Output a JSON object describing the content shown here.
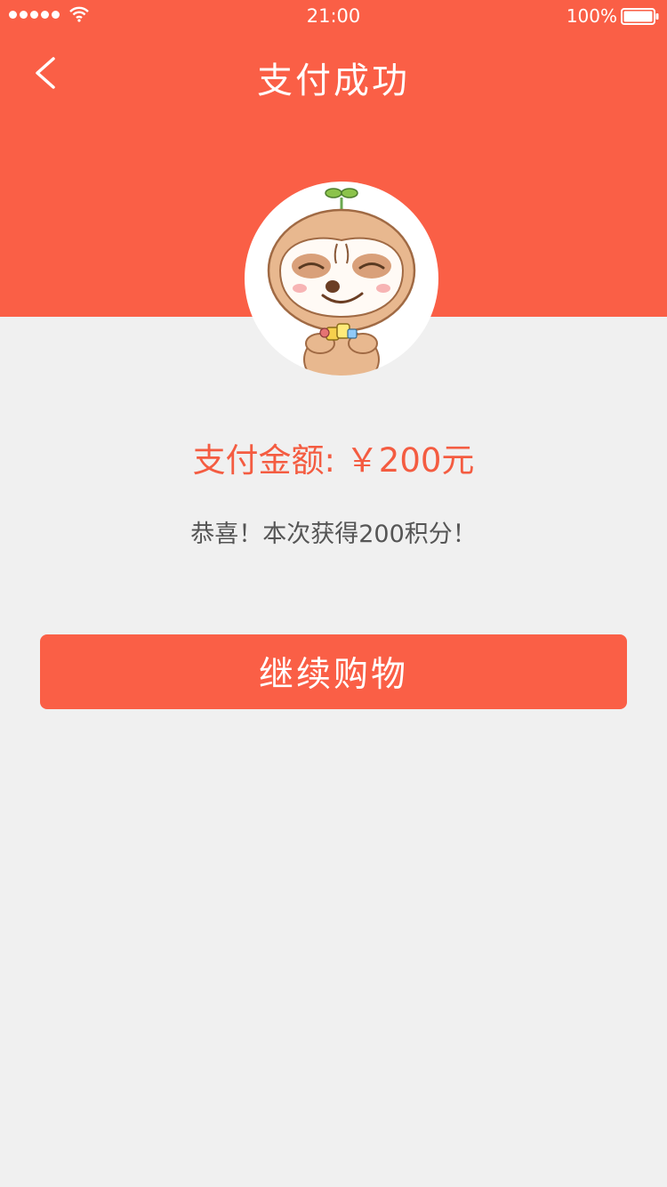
{
  "status_bar": {
    "time": "21:00",
    "battery_percent": "100%"
  },
  "nav": {
    "title": "支付成功",
    "back_icon": "chevron-left-icon"
  },
  "avatar": {
    "icon": "sloth-mascot-icon"
  },
  "payment": {
    "amount_text": "支付金额: ￥200元",
    "reward_text": "恭喜！本次获得200积分！"
  },
  "actions": {
    "continue_label": "继续购物"
  },
  "colors": {
    "accent": "#fa5f46",
    "background": "#f0f0f0",
    "amount_text": "#f45c41",
    "body_text": "#555555"
  }
}
